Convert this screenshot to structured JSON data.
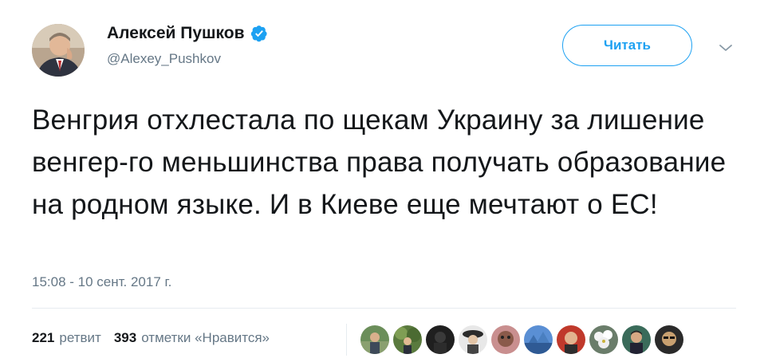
{
  "tweet": {
    "author": {
      "display_name": "Алексей Пушков",
      "handle": "@Alexey_Pushkov",
      "verified": true
    },
    "follow_label": "Читать",
    "text": "Венгрия отхлестала по щекам Украину за лишение венгер-го меньшинства права получать образование на родном языке. И в Киеве еще мечтают о ЕС!",
    "timestamp": "15:08 - 10 сент. 2017 г.",
    "retweets": {
      "count": "221",
      "label": "ретвит"
    },
    "likes": {
      "count": "393",
      "label": "отметки «Нравится»"
    },
    "liker_avatar_count_shown": 10
  },
  "colors": {
    "accent": "#1da1f2",
    "text": "#14171a",
    "secondary": "#657786",
    "divider": "#e6ecf0"
  },
  "icons": {
    "verified": "verified-badge-icon",
    "menu": "chevron-down-icon"
  }
}
